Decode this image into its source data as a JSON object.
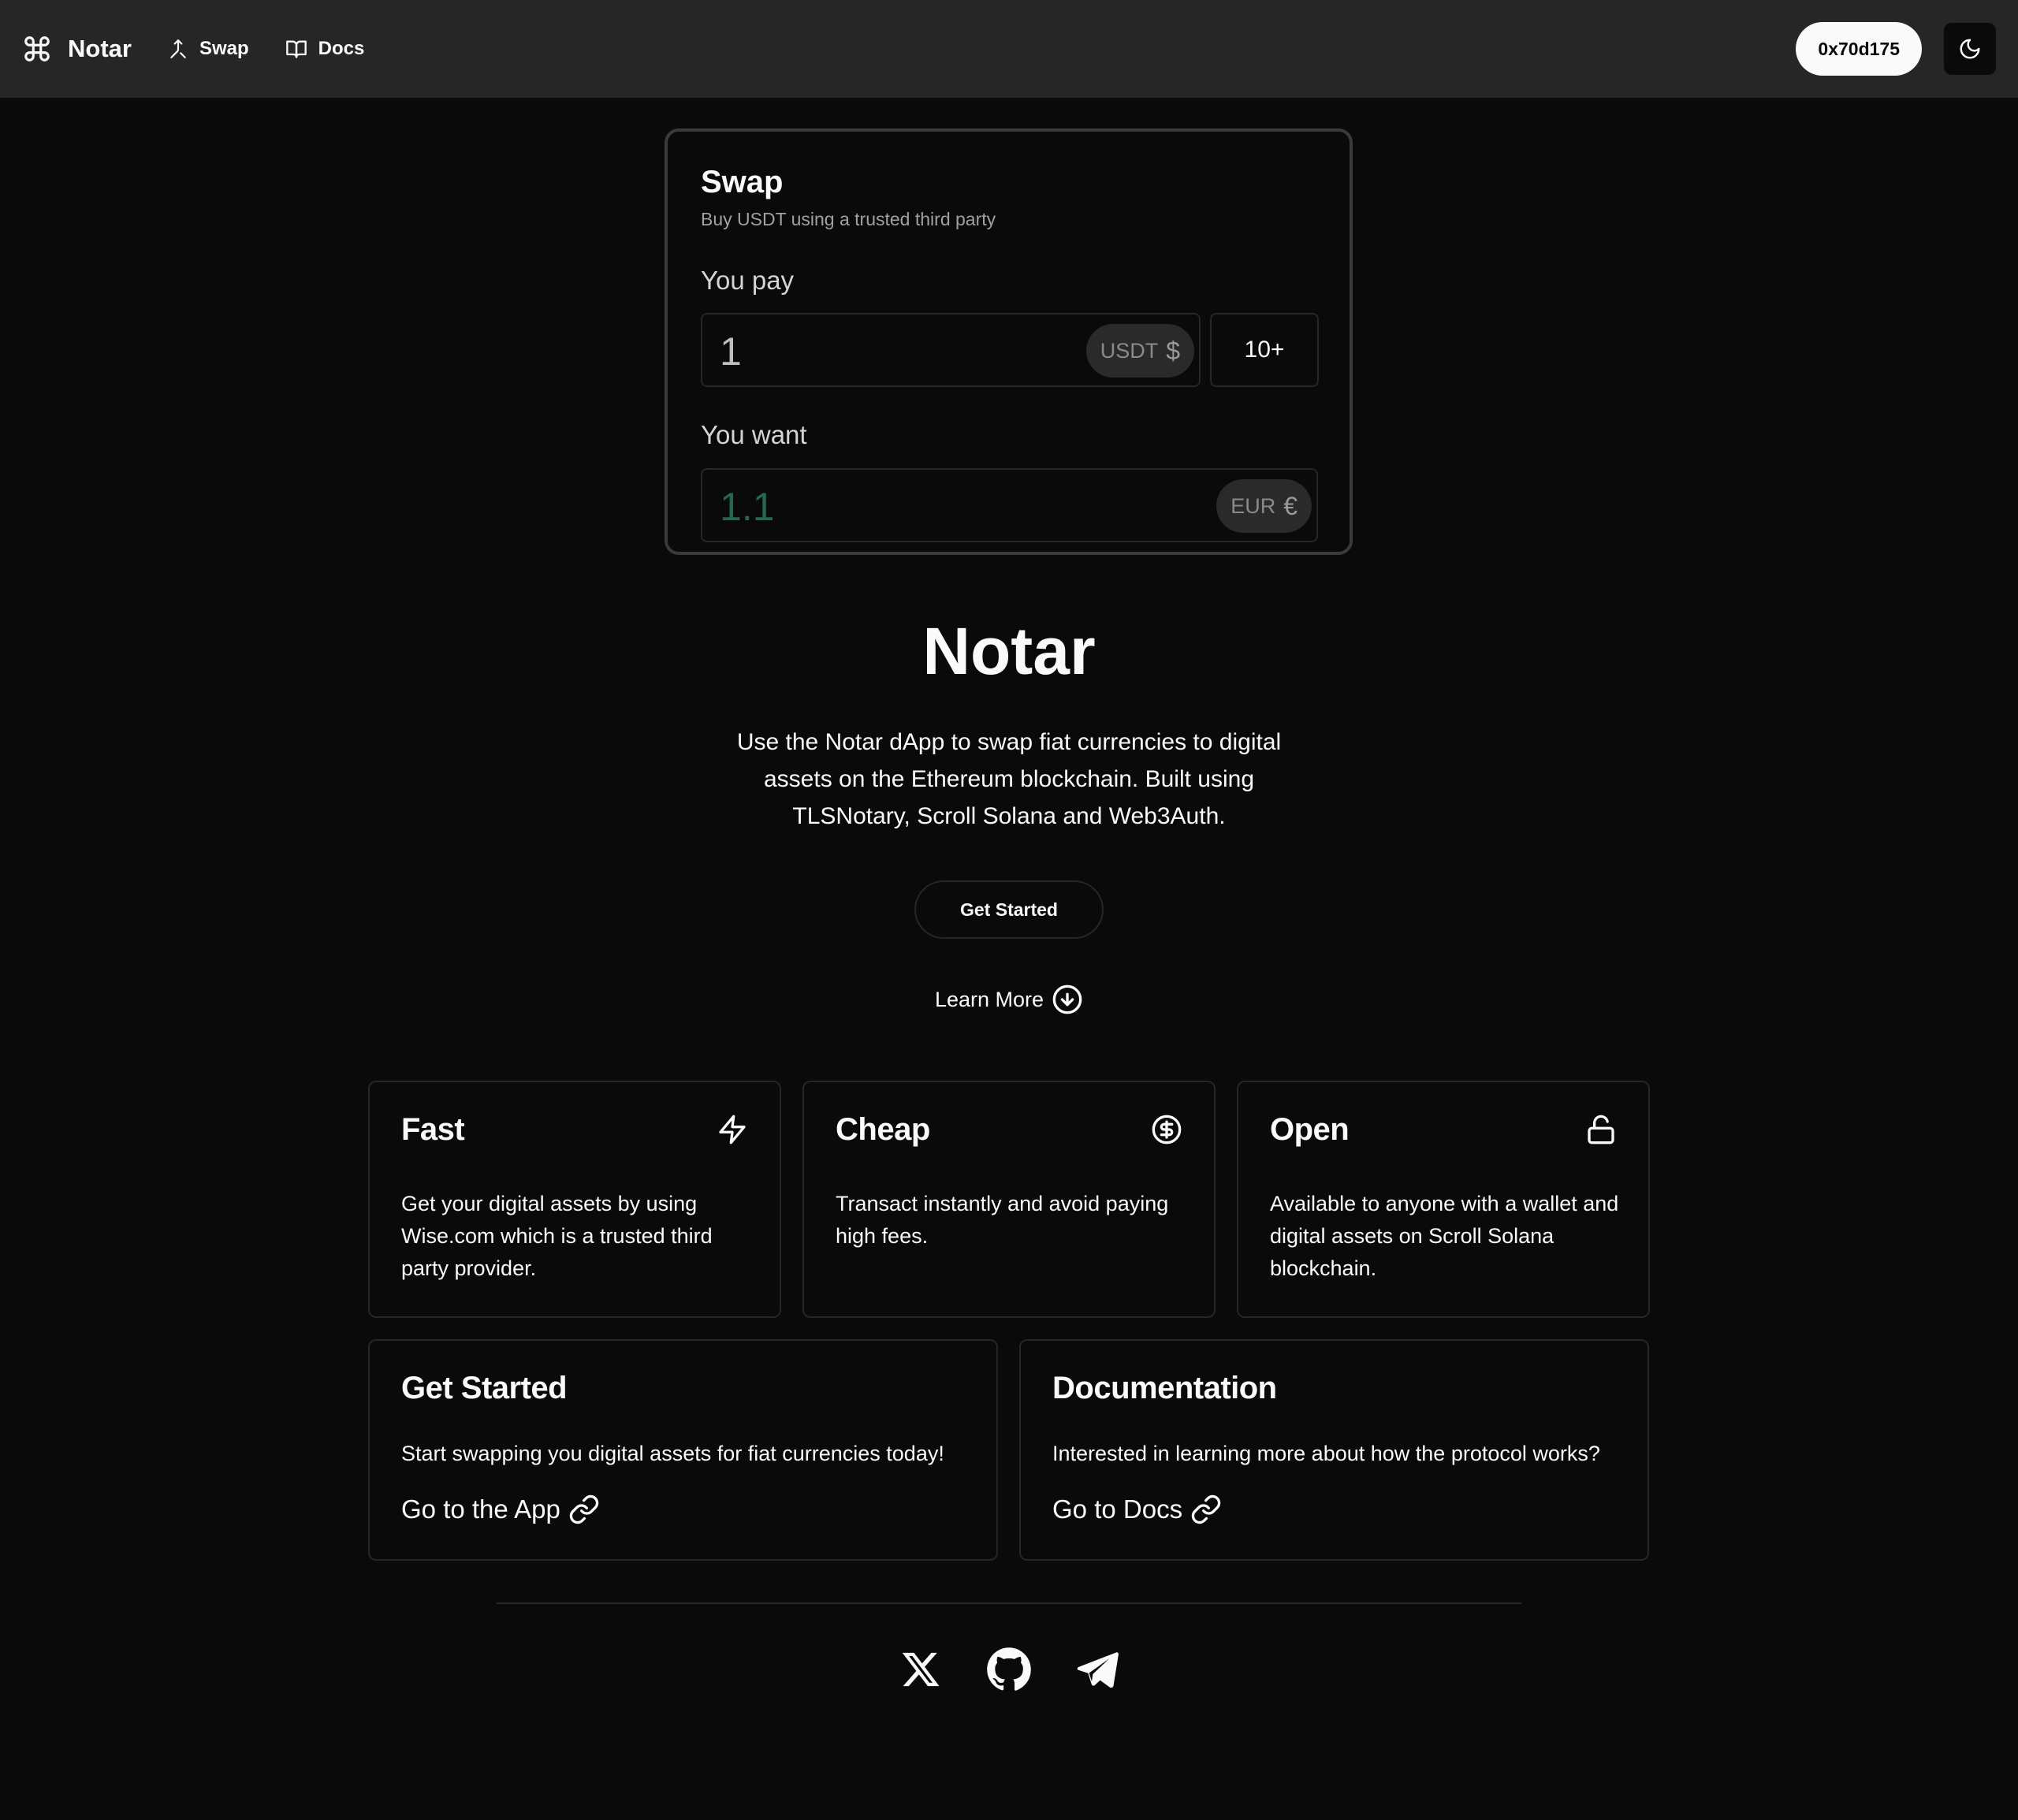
{
  "nav": {
    "brand": "Notar",
    "links": [
      {
        "label": "Swap",
        "icon": "swap-merge-icon"
      },
      {
        "label": "Docs",
        "icon": "book-icon"
      }
    ],
    "wallet_address": "0x70d175",
    "theme_icon": "moon-icon"
  },
  "swap": {
    "title": "Swap",
    "subtitle": "Buy USDT using a trusted third party",
    "pay_label": "You pay",
    "pay_amount": "1",
    "pay_currency": "USDT",
    "pay_symbol": "$",
    "preset": "10+",
    "want_label": "You want",
    "want_amount": "1.1",
    "want_currency": "EUR",
    "want_symbol": "€"
  },
  "hero": {
    "title": "Notar",
    "description": "Use the Notar dApp to swap fiat currencies to digital assets on the Ethereum blockchain. Built using TLSNotary, Scroll Solana and Web3Auth.",
    "cta": "Get Started",
    "learn_more": "Learn More"
  },
  "features": [
    {
      "title": "Fast",
      "icon": "zap-icon",
      "description": "Get your digital assets by using Wise.com which is a trusted third party provider."
    },
    {
      "title": "Cheap",
      "icon": "dollar-circle-icon",
      "description": "Transact instantly and avoid paying high fees."
    },
    {
      "title": "Open",
      "icon": "unlock-icon",
      "description": "Available to anyone with a wallet and digital assets on Scroll Solana blockchain."
    }
  ],
  "links": [
    {
      "title": "Get Started",
      "description": "Start swapping you digital assets for fiat currencies today!",
      "action": "Go to the App"
    },
    {
      "title": "Documentation",
      "description": "Interested in learning more about how the protocol works?",
      "action": "Go to Docs"
    }
  ],
  "footer": {
    "socials": [
      "x-icon",
      "github-icon",
      "telegram-icon"
    ]
  },
  "colors": {
    "background": "#0a0a0a",
    "navbar": "#262626",
    "accent_green": "#1f6b4c",
    "border": "#262626"
  }
}
